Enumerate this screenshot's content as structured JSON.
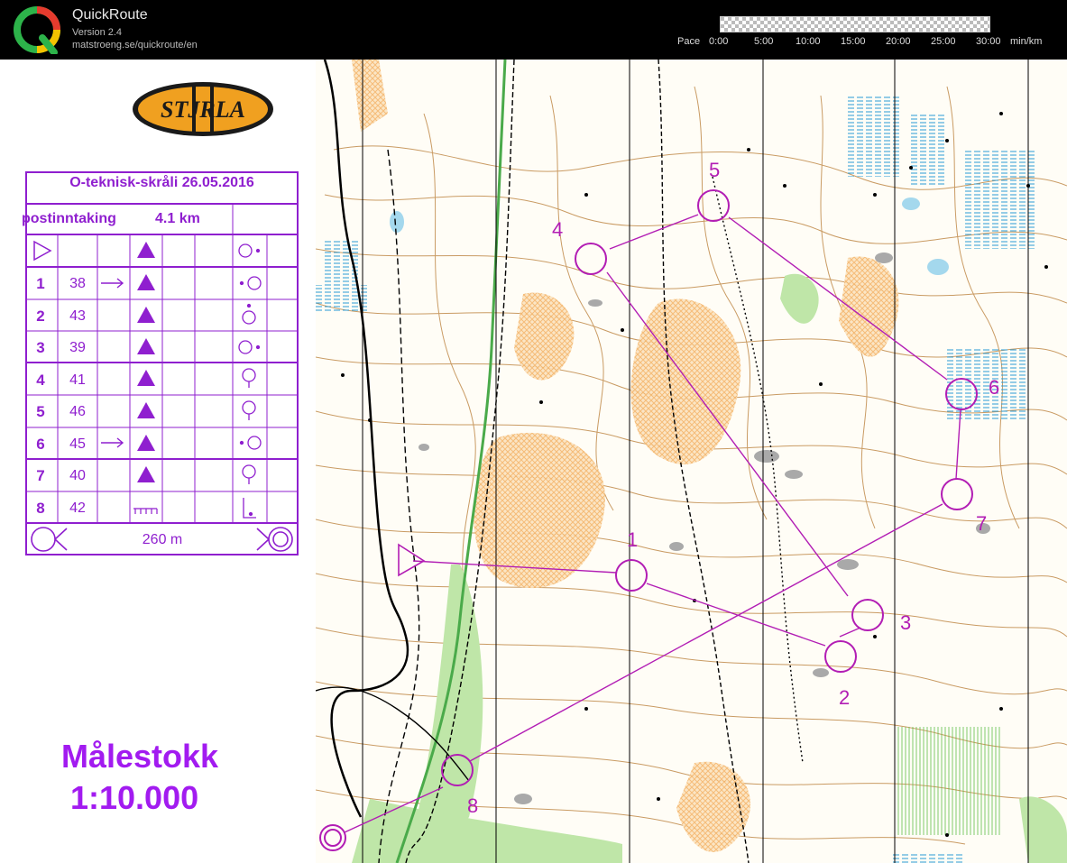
{
  "app": {
    "title": "QuickRoute",
    "version": "Version 2.4",
    "url": "matstroeng.se/quickroute/en",
    "icon": "quickroute-q-logo"
  },
  "pace": {
    "label": "Pace",
    "ticks": [
      "0:00",
      "5:00",
      "10:00",
      "15:00",
      "20:00",
      "25:00",
      "30:00"
    ],
    "unit": "min/km"
  },
  "club_logo": {
    "text": "STJRLA"
  },
  "description": {
    "title": "O-teknisk-skråli 26.05.2016",
    "class": "postinntaking",
    "length": "4.1 km",
    "rows": [
      {
        "num": "1",
        "code": "38"
      },
      {
        "num": "2",
        "code": "43"
      },
      {
        "num": "3",
        "code": "39"
      },
      {
        "num": "4",
        "code": "41"
      },
      {
        "num": "5",
        "code": "46"
      },
      {
        "num": "6",
        "code": "45"
      },
      {
        "num": "7",
        "code": "40"
      },
      {
        "num": "8",
        "code": "42"
      }
    ],
    "finish_distance": "260 m"
  },
  "scale": {
    "title": "Målestokk",
    "value": "1:10.000"
  },
  "course": {
    "color": "#b21db4",
    "labels": [
      "1",
      "2",
      "3",
      "4",
      "5",
      "6",
      "7",
      "8"
    ]
  }
}
